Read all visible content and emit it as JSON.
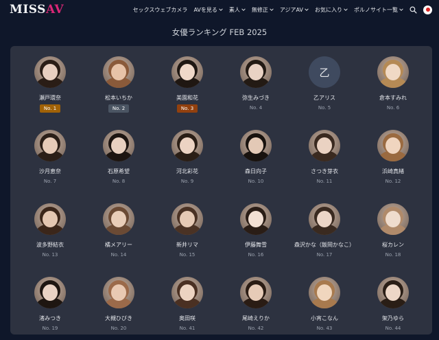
{
  "brand": {
    "prefix": "MISS",
    "suffix": "AV",
    "accent_color": "#db2777"
  },
  "nav": {
    "items": [
      {
        "label": "セックスウェブカメラ",
        "dropdown": false
      },
      {
        "label": "AVを見る",
        "dropdown": true
      },
      {
        "label": "素人",
        "dropdown": true
      },
      {
        "label": "無修正",
        "dropdown": true
      },
      {
        "label": "アジアAV",
        "dropdown": true
      },
      {
        "label": "お気に入り",
        "dropdown": true
      },
      {
        "label": "ポルノサイト一覧",
        "dropdown": true
      }
    ],
    "search_icon": "search-icon",
    "language_icon": "japan-flag-icon",
    "flag_color": "#dc2626"
  },
  "page": {
    "title": "女優ランキング FEB 2025"
  },
  "badge_colors": {
    "1": "#a16207",
    "2": "#4b5563",
    "3": "#92400e"
  },
  "actresses": [
    {
      "name": "瀬戸環奈",
      "rank": "No. 1",
      "badge": true,
      "tone": [
        "#e8cfc0",
        "#2a1d16"
      ]
    },
    {
      "name": "松本いちか",
      "rank": "No. 2",
      "badge": true,
      "tone": [
        "#e7c3a8",
        "#8a5a3a"
      ]
    },
    {
      "name": "美園和花",
      "rank": "No. 3",
      "badge": true,
      "tone": [
        "#efd8c8",
        "#1f1712"
      ]
    },
    {
      "name": "弥生みづき",
      "rank": "No. 4",
      "badge": false,
      "tone": [
        "#e9d2c4",
        "#231a14"
      ]
    },
    {
      "name": "乙アリス",
      "rank": "No. 5",
      "badge": false,
      "initial": "乙"
    },
    {
      "name": "倉本すみれ",
      "rank": "No. 6",
      "badge": false,
      "tone": [
        "#f0d9c5",
        "#b58a55"
      ]
    },
    {
      "name": "沙月恵奈",
      "rank": "No. 7",
      "badge": false,
      "tone": [
        "#e6cbb8",
        "#2b1f18"
      ]
    },
    {
      "name": "石原希望",
      "rank": "No. 8",
      "badge": false,
      "tone": [
        "#e8d0c0",
        "#1d1511"
      ]
    },
    {
      "name": "河北彩花",
      "rank": "No. 9",
      "badge": false,
      "tone": [
        "#ecd3c3",
        "#2a1e16"
      ]
    },
    {
      "name": "森日向子",
      "rank": "No. 10",
      "badge": false,
      "tone": [
        "#e3c9b6",
        "#18120e"
      ]
    },
    {
      "name": "さつき芽衣",
      "rank": "No. 11",
      "badge": false,
      "tone": [
        "#ead2c2",
        "#3a2a20"
      ]
    },
    {
      "name": "浜崎真緒",
      "rank": "No. 12",
      "badge": false,
      "tone": [
        "#f0d5bf",
        "#9a6a40"
      ]
    },
    {
      "name": "波多野結衣",
      "rank": "No. 13",
      "badge": false,
      "tone": [
        "#e4c7b2",
        "#3b261a"
      ]
    },
    {
      "name": "橘メアリー",
      "rank": "No. 14",
      "badge": false,
      "tone": [
        "#e9cdb8",
        "#6b4a34"
      ]
    },
    {
      "name": "新井リマ",
      "rank": "No. 15",
      "badge": false,
      "tone": [
        "#e6cab5",
        "#4a3224"
      ]
    },
    {
      "name": "伊藤舞雪",
      "rank": "No. 16",
      "badge": false,
      "tone": [
        "#f2e0d4",
        "#2a1d16"
      ]
    },
    {
      "name": "森沢かな（飯岡かなこ）",
      "rank": "No. 17",
      "badge": false,
      "tone": [
        "#ecd6c8",
        "#3a2a20"
      ]
    },
    {
      "name": "桜カレン",
      "rank": "No. 18",
      "badge": false,
      "tone": [
        "#efdccd",
        "#b08a6a"
      ]
    },
    {
      "name": "渚みつき",
      "rank": "No. 19",
      "badge": false,
      "tone": [
        "#ead3c4",
        "#1e1611"
      ]
    },
    {
      "name": "大槻ひびき",
      "rank": "No. 20",
      "badge": false,
      "tone": [
        "#e9c9b2",
        "#9b6a4a"
      ]
    },
    {
      "name": "奥田咲",
      "rank": "No. 41",
      "badge": false,
      "tone": [
        "#ecd3c1",
        "#4a3022"
      ]
    },
    {
      "name": "尾崎えりか",
      "rank": "No. 42",
      "badge": false,
      "tone": [
        "#e6cbb7",
        "#2a1c14"
      ]
    },
    {
      "name": "小宵こなん",
      "rank": "No. 43",
      "badge": false,
      "tone": [
        "#f0d6be",
        "#a87a4e"
      ]
    },
    {
      "name": "架乃ゆら",
      "rank": "No. 44",
      "badge": false,
      "tone": [
        "#edd7c7",
        "#2a1e16"
      ]
    }
  ]
}
